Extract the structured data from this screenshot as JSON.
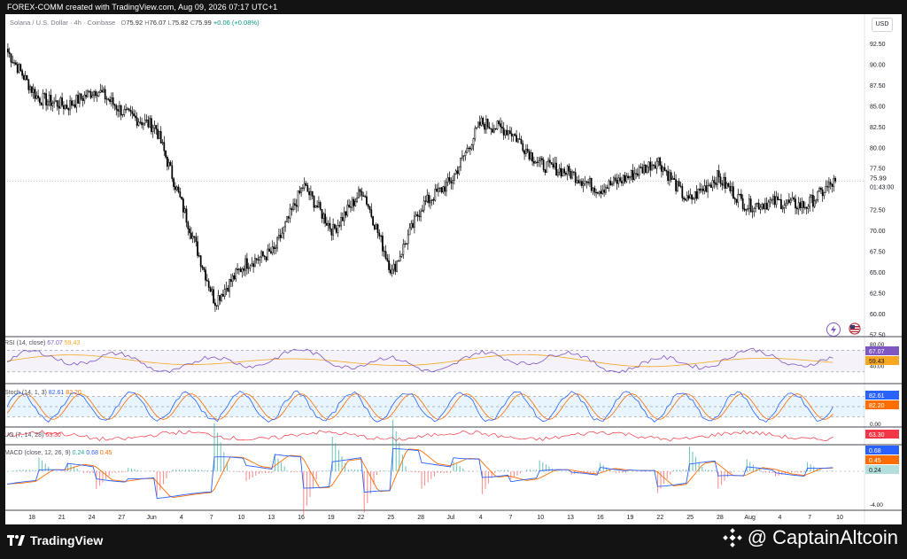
{
  "header": {
    "created_text": "FOREX-COMM created with TradingView.com, Aug 09, 2026 07:17 UTC+1"
  },
  "symbol": {
    "name": "Solana / U.S. Dollar · 4h · Coinbase",
    "o_label": "O",
    "o": "75.92",
    "h_label": "H",
    "h": "76.07",
    "l_label": "L",
    "l": "75.82",
    "c_label": "C",
    "c": "75.99",
    "change": "+0.06 (+0.08%)"
  },
  "currency_button": "USD",
  "price_axis": {
    "ticks": [
      "92.50",
      "90.00",
      "87.50",
      "85.00",
      "82.50",
      "80.00",
      "77.50",
      "72.50",
      "70.00",
      "67.50",
      "65.00",
      "62.50",
      "60.00",
      "57.50"
    ],
    "last_price": "75.99",
    "countdown": "01:43:00"
  },
  "time_axis": {
    "labels": [
      "18",
      "21",
      "24",
      "27",
      "Jun",
      "4",
      "7",
      "10",
      "13",
      "16",
      "19",
      "22",
      "25",
      "28",
      "Jul",
      "4",
      "7",
      "10",
      "13",
      "16",
      "19",
      "22",
      "25",
      "28",
      "Aug",
      "4",
      "7",
      "10"
    ]
  },
  "indicators": {
    "rsi": {
      "label": "RSI (14, close)",
      "v1": "67.07",
      "v2": "59.43",
      "axis": [
        "80.00",
        "40.00"
      ]
    },
    "stoch": {
      "label": "Stoch (14, 1, 3)",
      "v1": "82.61",
      "v2": "82.20",
      "axis": [
        "0.00"
      ]
    },
    "uo": {
      "label": "UO (7, 14, 28)",
      "v1": "63.30"
    },
    "macd": {
      "label": "MACD (close, 12, 26, 9)",
      "v1": "0.24",
      "v2": "0.68",
      "v3": "0.45",
      "axis": [
        "-4.00"
      ]
    }
  },
  "colors": {
    "candle": "#000000",
    "rsi_line": "#7e57c2",
    "rsi_ma": "#f7a721",
    "stoch_k": "#2962ff",
    "stoch_d": "#ff6d00",
    "uo": "#f23645",
    "macd": "#2962ff",
    "signal": "#ff6d00",
    "hist_pos": "#26a69a",
    "hist_neg": "#ff5252"
  },
  "footer": {
    "brand": "TradingView",
    "watermark": "@ CaptainAltcoin"
  },
  "chart_data": {
    "type": "candlestick",
    "title": "Solana / U.S. Dollar · 4h · Coinbase",
    "ylim": [
      57.5,
      93.5
    ],
    "x": [
      "May 16",
      "May 18",
      "May 21",
      "May 24",
      "May 27",
      "Jun 1",
      "Jun 4",
      "Jun 7",
      "Jun 10",
      "Jun 13",
      "Jun 16",
      "Jun 19",
      "Jun 22",
      "Jun 25",
      "Jun 28",
      "Jul 1",
      "Jul 4",
      "Jul 7",
      "Jul 10",
      "Jul 13",
      "Jul 16",
      "Jul 19",
      "Jul 22",
      "Jul 25",
      "Jul 28",
      "Aug 1",
      "Aug 4",
      "Aug 7",
      "Aug 9"
    ],
    "close": [
      91.5,
      86.0,
      85.0,
      87.0,
      84.0,
      82.5,
      72.0,
      61.5,
      66.0,
      67.5,
      75.5,
      70.0,
      75.0,
      65.0,
      73.0,
      76.0,
      83.0,
      82.0,
      78.0,
      77.0,
      75.0,
      76.5,
      78.5,
      73.5,
      76.5,
      73.0,
      73.5,
      73.0,
      75.99
    ]
  }
}
